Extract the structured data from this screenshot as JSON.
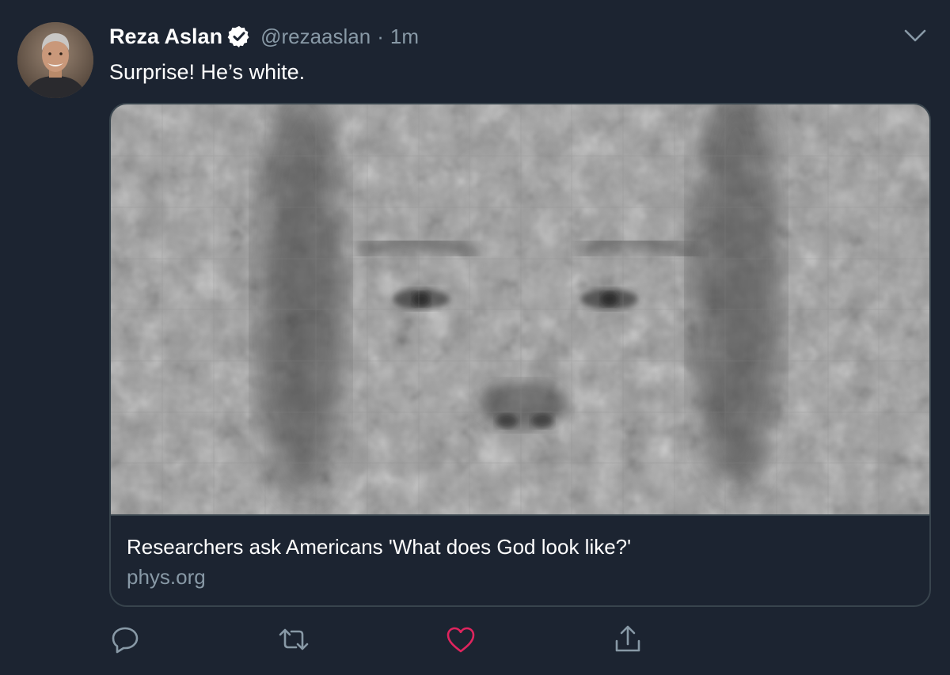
{
  "tweet": {
    "author_name": "Reza Aslan",
    "author_handle": "@rezaaslan",
    "separator": "·",
    "timestamp": "1m",
    "text": "Surprise! He’s white."
  },
  "card": {
    "title": "Researchers ask Americans 'What does God look like?'",
    "domain": "phys.org",
    "image_description_icon": "face-composite-image"
  },
  "icons": {
    "verified": "verified-badge-icon",
    "caret": "chevron-down-icon",
    "reply": "reply-icon",
    "retweet": "retweet-icon",
    "like": "heart-icon",
    "share": "share-icon"
  },
  "colors": {
    "background": "#1c2431",
    "text_primary": "#ffffff",
    "text_secondary": "#8899a6",
    "border": "#38444d",
    "like_accent": "#e0245e"
  }
}
